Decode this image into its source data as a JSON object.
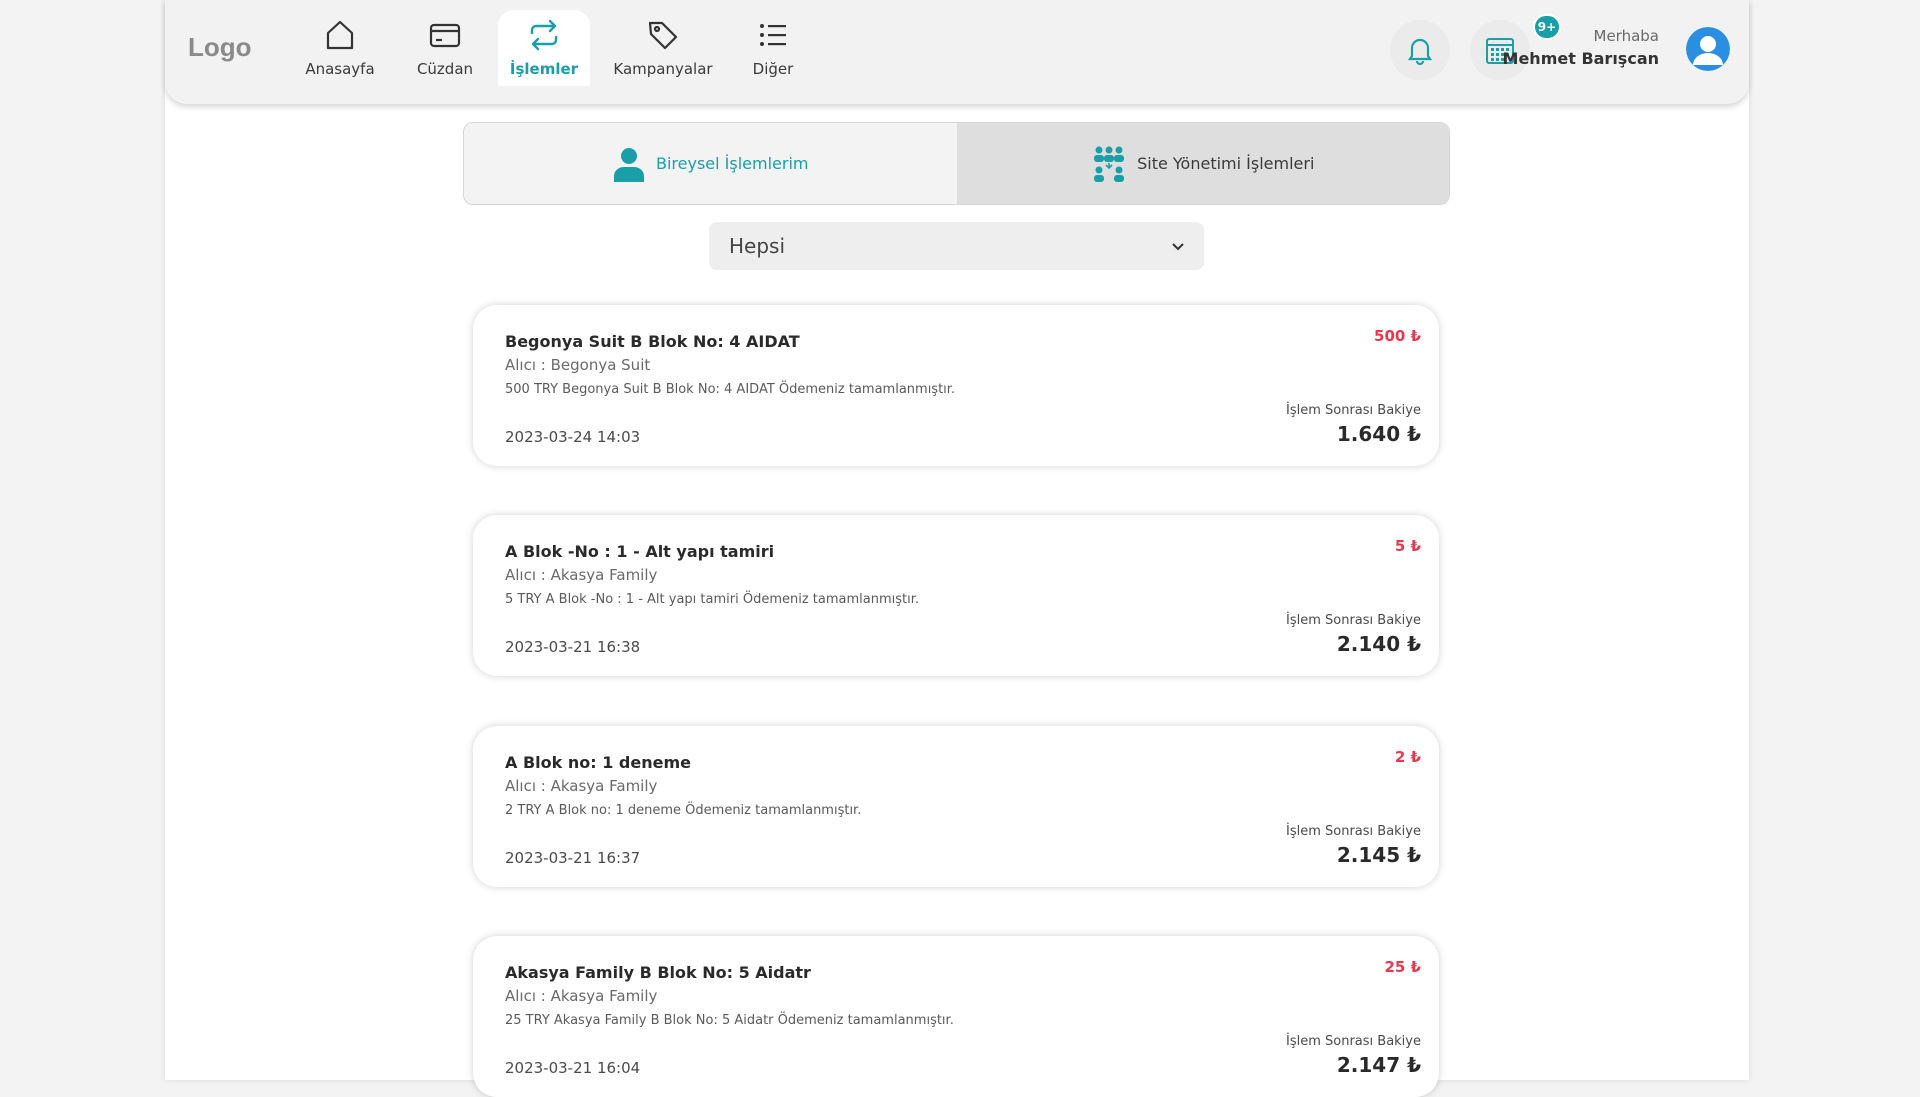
{
  "header": {
    "logo": "Logo",
    "nav": [
      {
        "label": "Anasayfa",
        "icon": "home-icon"
      },
      {
        "label": "Cüzdan",
        "icon": "wallet-icon"
      },
      {
        "label": "İşlemler",
        "icon": "transactions-icon",
        "active": true
      },
      {
        "label": "Kampanyalar",
        "icon": "tag-icon"
      },
      {
        "label": "Diğer",
        "icon": "list-icon"
      }
    ],
    "notification_badge": "9+",
    "greeting": "Merhaba",
    "user_name": "Mehmet Barışcan"
  },
  "tabs": [
    {
      "label": "Bireysel İşlemlerim",
      "icon": "person-icon",
      "active": true
    },
    {
      "label": "Site Yönetimi İşlemleri",
      "icon": "group-icon",
      "active": false
    }
  ],
  "filter": {
    "selected": "Hepsi"
  },
  "balance_label": "İşlem Sonrası Bakiye",
  "transactions": [
    {
      "title": "Begonya Suit B Blok No: 4 AIDAT",
      "recipient": "Alıcı : Begonya Suit",
      "description": "500 TRY Begonya Suit B Blok No: 4 AIDAT Ödemeniz tamamlanmıştır.",
      "date": "2023-03-24 14:03",
      "amount": "500 ₺",
      "balance": "1.640 ₺"
    },
    {
      "title": "A Blok -No : 1 - Alt yapı tamiri",
      "recipient": "Alıcı : Akasya Family",
      "description": "5 TRY A Blok -No : 1 - Alt yapı tamiri Ödemeniz tamamlanmıştır.",
      "date": "2023-03-21 16:38",
      "amount": "5 ₺",
      "balance": "2.140 ₺"
    },
    {
      "title": "A Blok no: 1 deneme",
      "recipient": "Alıcı : Akasya Family",
      "description": "2 TRY A Blok no: 1 deneme Ödemeniz tamamlanmıştır.",
      "date": "2023-03-21 16:37",
      "amount": "2 ₺",
      "balance": "2.145 ₺"
    },
    {
      "title": "Akasya Family B Blok No: 5 Aidatr",
      "recipient": "Alıcı : Akasya Family",
      "description": "25 TRY Akasya Family B Blok No: 5 Aidatr Ödemeniz tamamlanmıştır.",
      "date": "2023-03-21 16:04",
      "amount": "25 ₺",
      "balance": "2.147 ₺"
    }
  ],
  "colors": {
    "accent": "#1a9fa8",
    "debit": "#e8384f"
  }
}
